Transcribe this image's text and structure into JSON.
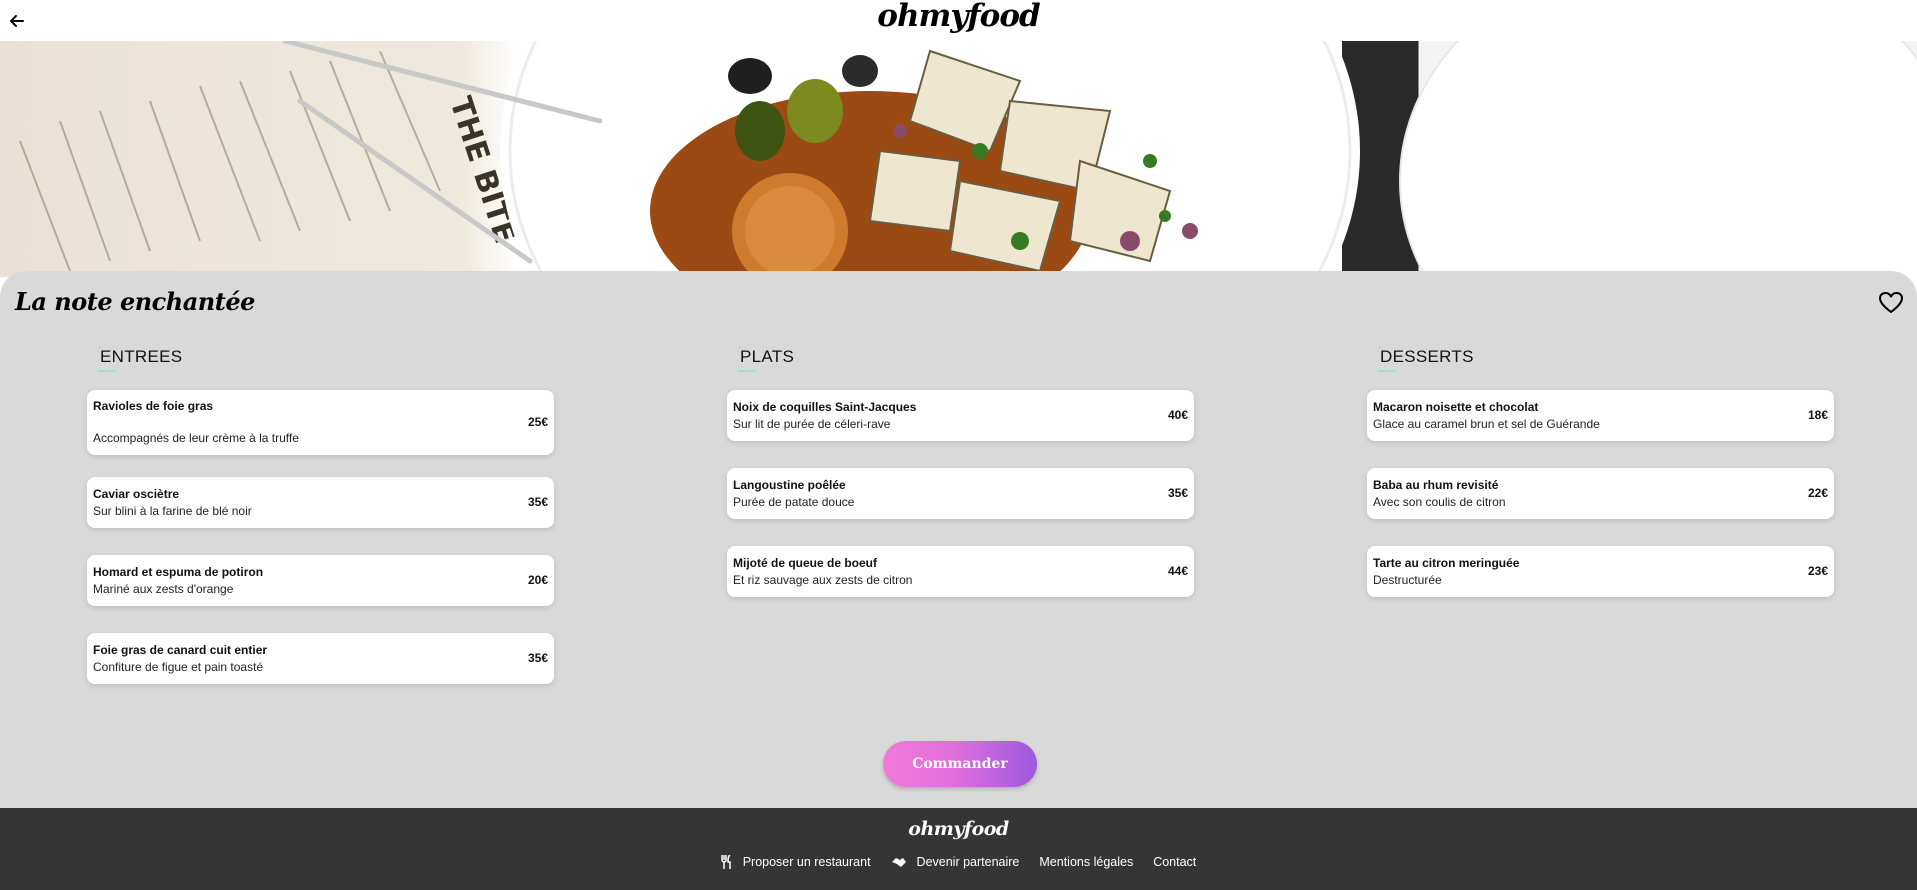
{
  "header": {
    "logo": "ohmyfood",
    "back_icon": "arrow-left-icon"
  },
  "restaurant": {
    "name": "La note enchantée",
    "favorite_icon": "heart-icon"
  },
  "menu": [
    {
      "title": "ENTREES",
      "items": [
        {
          "name": "Ravioles de foie gras",
          "desc": "Accompagnés de leur crème à la truffe",
          "price": "25€"
        },
        {
          "name": "Caviar osciètre",
          "desc": "Sur blini à la farine de blé noir",
          "price": "35€"
        },
        {
          "name": "Homard et espuma de potiron",
          "desc": "Mariné aux zests d'orange",
          "price": "20€"
        },
        {
          "name": "Foie gras de canard cuit entier",
          "desc": "Confiture de figue et pain toasté",
          "price": "35€"
        }
      ]
    },
    {
      "title": "PLATS",
      "items": [
        {
          "name": "Noix de coquilles Saint-Jacques",
          "desc": "Sur lit de purée de céleri-rave",
          "price": "40€"
        },
        {
          "name": "Langoustine poêlée",
          "desc": "Purée de patate douce",
          "price": "35€"
        },
        {
          "name": "Mijoté de queue de boeuf",
          "desc": "Et riz sauvage aux zests de citron",
          "price": "44€"
        }
      ]
    },
    {
      "title": "DESSERTS",
      "items": [
        {
          "name": "Macaron noisette et chocolat",
          "desc": "Glace au caramel brun et sel de Guérande",
          "price": "18€"
        },
        {
          "name": "Baba au rhum revisité",
          "desc": "Avec son coulis de citron",
          "price": "22€"
        },
        {
          "name": "Tarte au citron meringuée",
          "desc": "Destructurée",
          "price": "23€"
        }
      ]
    }
  ],
  "order_button": "Commander",
  "footer": {
    "logo": "ohmyfood",
    "links": [
      {
        "label": "Proposer un restaurant",
        "icon": "utensils-icon"
      },
      {
        "label": "Devenir partenaire",
        "icon": "handshake-icon"
      },
      {
        "label": "Mentions légales",
        "icon": ""
      },
      {
        "label": "Contact",
        "icon": ""
      }
    ]
  },
  "colors": {
    "panel_bg": "#d9d9d9",
    "footer_bg": "#353535",
    "accent": "#99e2d0",
    "button_start": "#f07ad8",
    "button_end": "#9c58df"
  }
}
